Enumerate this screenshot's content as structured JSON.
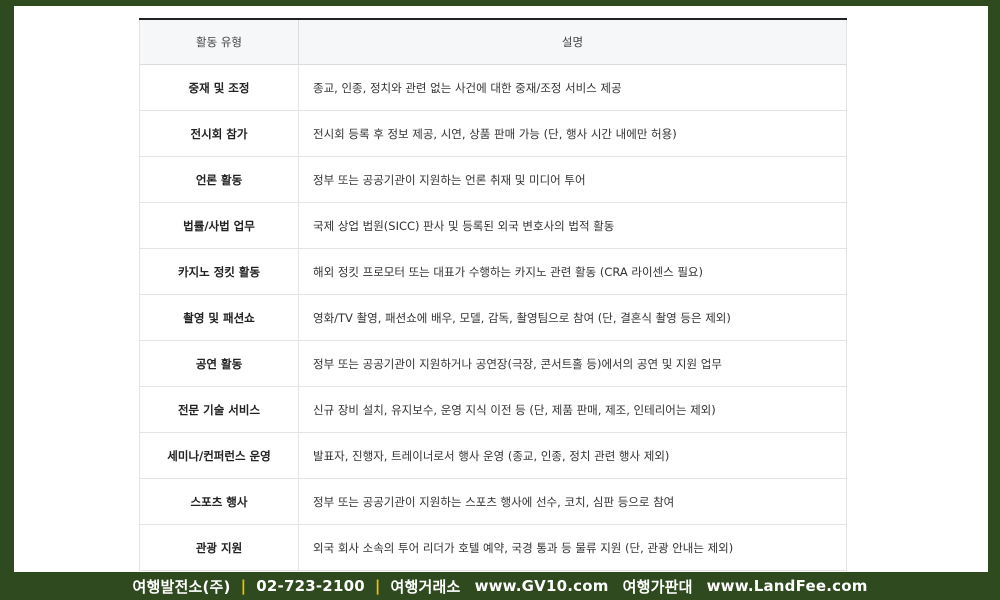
{
  "table": {
    "headers": [
      "활동 유형",
      "설명"
    ],
    "rows": [
      {
        "type": "중재 및 조정",
        "desc": "종교, 인종, 정치와 관련 없는 사건에 대한 중재/조정 서비스 제공"
      },
      {
        "type": "전시회 참가",
        "desc": "전시회 등록 후 정보 제공, 시연, 상품 판매 가능 (단, 행사 시간 내에만 허용)"
      },
      {
        "type": "언론 활동",
        "desc": "정부 또는 공공기관이 지원하는 언론 취재 및 미디어 투어"
      },
      {
        "type": "법률/사법 업무",
        "desc": "국제 상업 법원(SICC) 판사 및 등록된 외국 변호사의 법적 활동"
      },
      {
        "type": "카지노 정킷 활동",
        "desc": "해외 정킷 프로모터 또는 대표가 수행하는 카지노 관련 활동 (CRA 라이센스 필요)"
      },
      {
        "type": "촬영 및 패션쇼",
        "desc": "영화/TV 촬영, 패션쇼에 배우, 모델, 감독, 촬영팀으로 참여 (단, 결혼식 촬영 등은 제외)"
      },
      {
        "type": "공연 활동",
        "desc": "정부 또는 공공기관이 지원하거나 공연장(극장, 콘서트홀 등)에서의 공연 및 지원 업무"
      },
      {
        "type": "전문 기술 서비스",
        "desc": "신규 장비 설치, 유지보수, 운영 지식 이전 등 (단, 제품 판매, 제조, 인테리어는 제외)"
      },
      {
        "type": "세미나/컨퍼런스 운영",
        "desc": "발표자, 진행자, 트레이너로서 행사 운영 (종교, 인종, 정치 관련 행사 제외)"
      },
      {
        "type": "스포츠 행사",
        "desc": "정부 또는 공공기관이 지원하는 스포츠 행사에 선수, 코치, 심판 등으로 참여"
      },
      {
        "type": "관광 지원",
        "desc": "외국 회사 소속의 투어 리더가 호텔 예약, 국경 통과 등 물류 지원 (단, 관광 안내는 제외)"
      }
    ]
  },
  "footer": {
    "company": "여행발전소(주)",
    "phone": "02-723-2100",
    "brand1": "여행거래소",
    "site1": "www.GV10.com",
    "brand2": "여행가판대",
    "site2": "www.LandFee.com",
    "separator": "|"
  },
  "colors": {
    "frame": "#2f4a1f",
    "separator": "#f2c200"
  }
}
